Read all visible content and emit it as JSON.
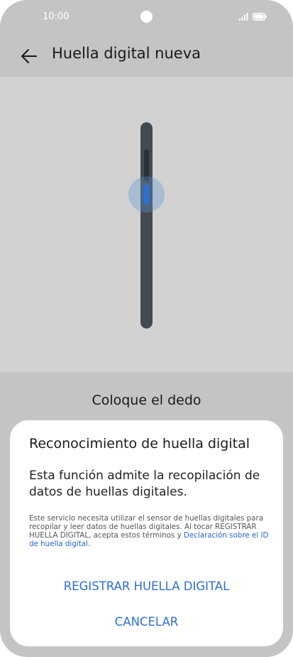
{
  "status_bar": {
    "time": "10:00",
    "icons": [
      "camera-cutout",
      "signal-icon",
      "battery-icon"
    ]
  },
  "header": {
    "back_icon": "arrow-left-icon",
    "title": "Huella digital nueva"
  },
  "illustration": {
    "description_icon": "phone-side-fingerprint-sensor",
    "sensor_color": "#2f6fcf"
  },
  "instruction": "Coloque el dedo",
  "dialog": {
    "title": "Reconocimiento de huella digital",
    "body": "Esta función admite la recopilación de datos de huellas digitales.",
    "note": "Este servicio necesita utilizar el sensor de huellas digitales para recopilar y leer datos de huellas digitales. Al tocar REGISTRAR HUELLA DIGITAL, acepta estos términos y ",
    "note_link": "Declaración sobre el ID de huella digital",
    "note_end": ".",
    "register_label": "REGISTRAR HUELLA DIGITAL",
    "cancel_label": "CANCELAR"
  },
  "colors": {
    "background": "#c4c4c4",
    "accent": "#2f6fd6",
    "dialog": "#ffffff"
  }
}
